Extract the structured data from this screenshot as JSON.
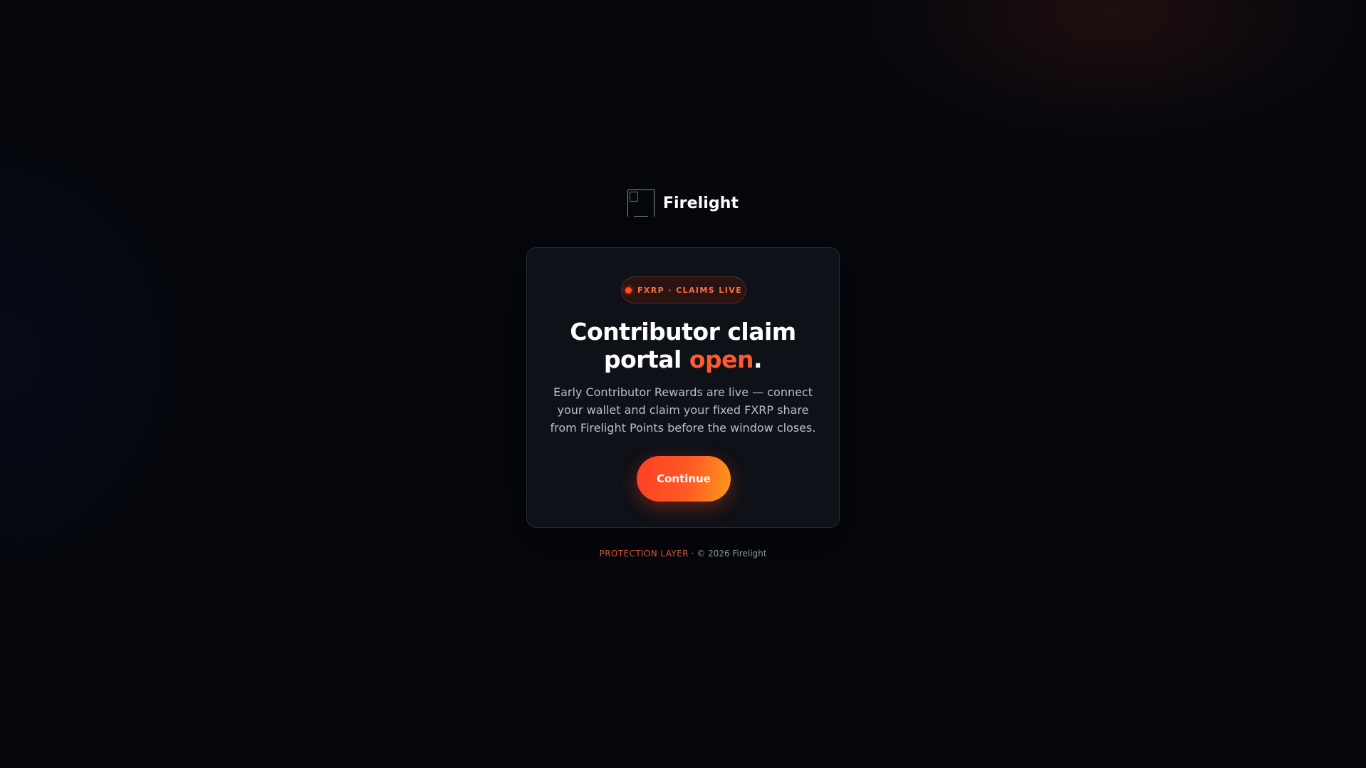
{
  "brand": {
    "name": "Firelight",
    "logo_icon": "broken-image-icon"
  },
  "card": {
    "badge": "FXRP · CLAIMS LIVE",
    "headline_part1": "Contributor claim",
    "headline_part2": "portal ",
    "headline_accent": "open",
    "headline_end": ".",
    "description": "Early Contributor Rewards are live — connect your wallet and claim your fixed FXRP share from Firelight Points before the window closes.",
    "button_label": "Continue"
  },
  "footer": {
    "tag": "PROTECTION LAYER",
    "separator": " · ",
    "copyright": "© 2026 Firelight"
  },
  "colors": {
    "accent": "#ff5a2d",
    "background": "#05070d",
    "card": "#0e1117"
  }
}
